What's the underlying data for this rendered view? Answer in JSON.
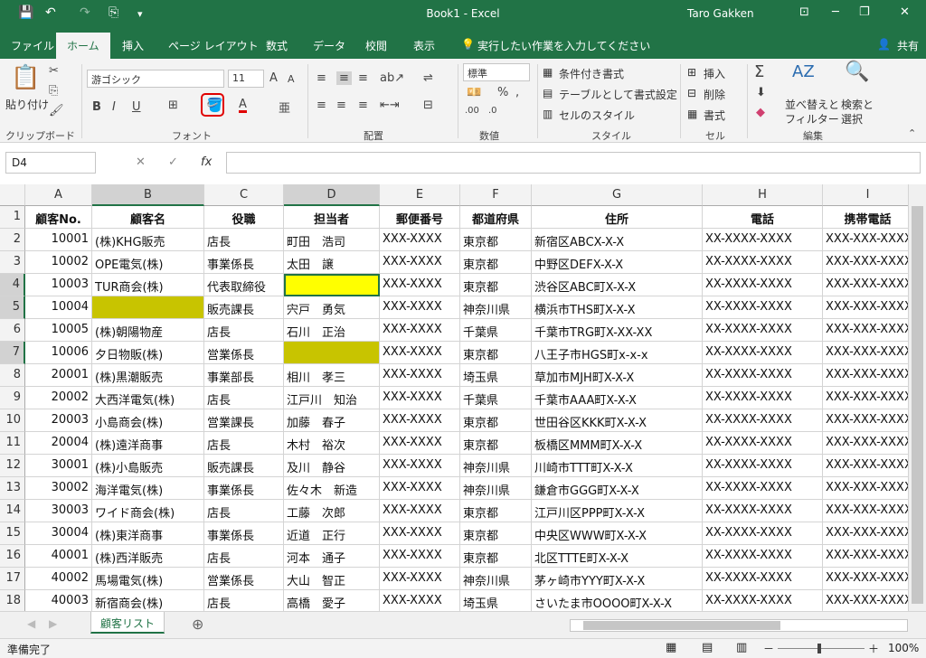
{
  "window": {
    "title": "Book1 - Excel",
    "user": "Taro Gakken",
    "min": "─",
    "restore": "❐",
    "close": "✕",
    "ribbon_display": "⊡"
  },
  "qat": {
    "save": "💾",
    "undo": "↶",
    "redo": "↷",
    "touch": "⎘",
    "customize": "▾"
  },
  "tabs": [
    "ファイル",
    "ホーム",
    "挿入",
    "ページ レイアウト",
    "数式",
    "データ",
    "校閲",
    "表示"
  ],
  "tell_me": "実行したい作業を入力してください",
  "share": "共有",
  "ribbon": {
    "clipboard": {
      "label": "クリップボード",
      "paste": "貼り付け"
    },
    "font": {
      "label": "フォント",
      "name": "游ゴシック",
      "size": "11",
      "bold": "B",
      "italic": "I",
      "underline": "U",
      "grow": "A",
      "shrink": "A",
      "color_letter": "A"
    },
    "alignment": {
      "label": "配置"
    },
    "number": {
      "label": "数値",
      "format": "標準"
    },
    "styles": {
      "label": "スタイル",
      "conditional": "条件付き書式",
      "table": "テーブルとして書式設定",
      "cell_styles": "セルのスタイル"
    },
    "cells": {
      "label": "セル",
      "insert": "挿入",
      "delete": "削除",
      "format": "書式"
    },
    "editing": {
      "label": "編集",
      "sort": "並べ替えと",
      "sort2": "フィルター",
      "find": "検索と",
      "find2": "選択"
    }
  },
  "formula": {
    "namebox": "D4",
    "fx": "fx",
    "cancel": "✕",
    "enter": "✓",
    "value": ""
  },
  "columns": [
    "A",
    "B",
    "C",
    "D",
    "E",
    "F",
    "G",
    "H",
    "I"
  ],
  "row_numbers": [
    "1",
    "2",
    "3",
    "4",
    "5",
    "6",
    "7",
    "8",
    "9",
    "10",
    "11",
    "12",
    "13",
    "14",
    "15",
    "16",
    "17",
    "18"
  ],
  "headers": [
    "顧客No.",
    "顧客名",
    "役職",
    "担当者",
    "郵便番号",
    "都道府県",
    "住所",
    "電話",
    "携帯電話"
  ],
  "rows": [
    [
      "10001",
      "(株)KHG販売",
      "店長",
      "町田　浩司",
      "XXX-XXXX",
      "東京都",
      "新宿区ABCX-X-X",
      "XX-XXXX-XXXX",
      "XXX-XXX-XXXX"
    ],
    [
      "10002",
      "OPE電気(株)",
      "事業係長",
      "太田　譲",
      "XXX-XXXX",
      "東京都",
      "中野区DEFX-X-X",
      "XX-XXXX-XXXX",
      "XXX-XXX-XXXX"
    ],
    [
      "10003",
      "TUR商会(株)",
      "代表取締役",
      "",
      "XXX-XXXX",
      "東京都",
      "渋谷区ABC町X-X-X",
      "XX-XXXX-XXXX",
      "XXX-XXX-XXXX"
    ],
    [
      "10004",
      "",
      "販売課長",
      "宍戸　勇気",
      "XXX-XXXX",
      "神奈川県",
      "横浜市THS町X-X-X",
      "XX-XXXX-XXXX",
      "XXX-XXX-XXXX"
    ],
    [
      "10005",
      "(株)朝陽物産",
      "店長",
      "石川　正治",
      "XXX-XXXX",
      "千葉県",
      "千葉市TRG町X-XX-XX",
      "XX-XXXX-XXXX",
      "XXX-XXX-XXXX"
    ],
    [
      "10006",
      "夕日物販(株)",
      "営業係長",
      "",
      "XXX-XXXX",
      "東京都",
      "八王子市HGS町x-x-x",
      "XX-XXXX-XXXX",
      "XXX-XXX-XXXX"
    ],
    [
      "20001",
      "(株)黒潮販売",
      "事業部長",
      "相川　孝三",
      "XXX-XXXX",
      "埼玉県",
      "草加市MJH町X-X-X",
      "XX-XXXX-XXXX",
      "XXX-XXX-XXXX"
    ],
    [
      "20002",
      "大西洋電気(株)",
      "店長",
      "江戸川　知治",
      "XXX-XXXX",
      "千葉県",
      "千葉市AAA町X-X-X",
      "XX-XXXX-XXXX",
      "XXX-XXX-XXXX"
    ],
    [
      "20003",
      "小島商会(株)",
      "営業課長",
      "加藤　春子",
      "XXX-XXXX",
      "東京都",
      "世田谷区KKK町X-X-X",
      "XX-XXXX-XXXX",
      "XXX-XXX-XXXX"
    ],
    [
      "20004",
      "(株)遠洋商事",
      "店長",
      "木村　裕次",
      "XXX-XXXX",
      "東京都",
      "板橋区MMM町X-X-X",
      "XX-XXXX-XXXX",
      "XXX-XXX-XXXX"
    ],
    [
      "30001",
      "(株)小島販売",
      "販売課長",
      "及川　静谷",
      "XXX-XXXX",
      "神奈川県",
      "川崎市TTT町X-X-X",
      "XX-XXXX-XXXX",
      "XXX-XXX-XXXX"
    ],
    [
      "30002",
      "海洋電気(株)",
      "事業係長",
      "佐々木　新造",
      "XXX-XXXX",
      "神奈川県",
      "鎌倉市GGG町X-X-X",
      "XX-XXXX-XXXX",
      "XXX-XXX-XXXX"
    ],
    [
      "30003",
      "ワイド商会(株)",
      "店長",
      "工藤　次郎",
      "XXX-XXXX",
      "東京都",
      "江戸川区PPP町X-X-X",
      "XX-XXXX-XXXX",
      "XXX-XXX-XXXX"
    ],
    [
      "30004",
      "(株)東洋商事",
      "事業係長",
      "近道　正行",
      "XXX-XXXX",
      "東京都",
      "中央区WWW町X-X-X",
      "XX-XXXX-XXXX",
      "XXX-XXX-XXXX"
    ],
    [
      "40001",
      "(株)西洋販売",
      "店長",
      "河本　通子",
      "XXX-XXXX",
      "東京都",
      "北区TTTE町X-X-X",
      "XX-XXXX-XXXX",
      "XXX-XXX-XXXX"
    ],
    [
      "40002",
      "馬場電気(株)",
      "営業係長",
      "大山　智正",
      "XXX-XXXX",
      "神奈川県",
      "茅ヶ崎市YYY町X-X-X",
      "XX-XXXX-XXXX",
      "XXX-XXX-XXXX"
    ],
    [
      "40003",
      "新宿商会(株)",
      "店長",
      "高橋　愛子",
      "XXX-XXXX",
      "埼玉県",
      "さいたま市OOOO町X-X-X",
      "XX-XXXX-XXXX",
      "XXX-XXX-XXXX"
    ]
  ],
  "fills": {
    "yellow": "#ffff00",
    "olive": "#c8c400"
  },
  "sheet_tab": "顧客リスト",
  "add_sheet": "⊕",
  "status": {
    "ready": "準備完了",
    "zoom": "100%",
    "minus": "－",
    "plus": "＋"
  }
}
